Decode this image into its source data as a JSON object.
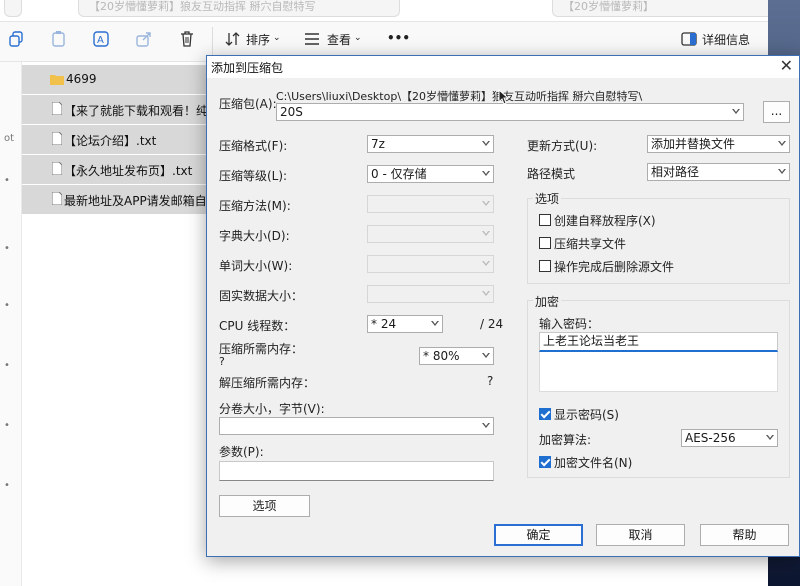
{
  "explorer": {
    "tab_left": "【20岁懵懂萝莉】狼友互动指挥 掰穴自慰特写",
    "tab_right": "【20岁懵懂萝莉】",
    "toolbar": {
      "sort_label": "排序",
      "view_label": "查看",
      "more_label": "•••",
      "details_label": "详细信息"
    },
    "files": [
      {
        "name": "4699",
        "kind": "folder"
      },
      {
        "name": "【来了就能下载和观看！纯免费",
        "kind": "file"
      },
      {
        "name": "【论坛介绍】.txt",
        "kind": "file"
      },
      {
        "name": "【永久地址发布页】.txt",
        "kind": "file"
      },
      {
        "name": "最新地址及APP请发邮箱自动回",
        "kind": "file"
      }
    ],
    "sidebar_label": "ot"
  },
  "dialog": {
    "title": "添加到压缩包",
    "archive_label": "压缩包(A):",
    "archive_path": "C:\\Users\\liuxi\\Desktop\\【20岁懵懂萝莉】狼友互动听指挥 掰穴自慰特写\\",
    "archive_name": "20S",
    "browse_label": "...",
    "left": {
      "format_label": "压缩格式(F):",
      "format_value": "7z",
      "level_label": "压缩等级(L):",
      "level_value": "0 - 仅存储",
      "method_label": "压缩方法(M):",
      "dict_label": "字典大小(D):",
      "word_label": "单词大小(W):",
      "solid_label": "固实数据大小：",
      "cpu_label": "CPU 线程数：",
      "cpu_value": "* 24",
      "cpu_total": "/ 24",
      "mem_comp_label": "压缩所需内存：",
      "mem_comp_q": "?",
      "mem_comp_value": "* 80%",
      "mem_decomp_label": "解压缩所需内存：",
      "mem_decomp_value": "?",
      "volume_label": "分卷大小，字节(V):",
      "params_label": "参数(P):",
      "options_button": "选项"
    },
    "right": {
      "update_label": "更新方式(U):",
      "update_value": "添加并替换文件",
      "path_label": "路径模式",
      "path_value": "相对路径",
      "options_group": "选项",
      "opt_sfx": "创建自释放程序(X)",
      "opt_shared": "压缩共享文件",
      "opt_delete": "操作完成后删除源文件",
      "encrypt_group": "加密",
      "pwd_label": "输入密码：",
      "pwd_value": "上老王论坛当老王",
      "show_pwd": "显示密码(S)",
      "algo_label": "加密算法:",
      "algo_value": "AES-256",
      "encrypt_names": "加密文件名(N)"
    },
    "ok_button": "确定",
    "cancel_button": "取消",
    "help_button": "帮助"
  }
}
